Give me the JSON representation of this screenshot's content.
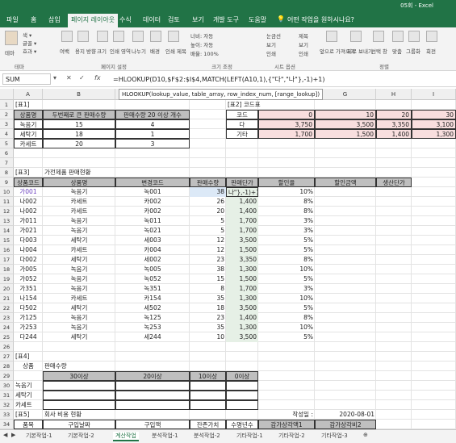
{
  "window": {
    "title": "05회 - Excel"
  },
  "tabs": [
    "파일",
    "홈",
    "삽입",
    "페이지 레이아웃",
    "수식",
    "데이터",
    "검토",
    "보기",
    "개발 도구",
    "도움말"
  ],
  "search": "어떤 작업을 원하시나요?",
  "ribbon": {
    "groups": [
      "테마",
      "페이지 설정",
      "크기 조정",
      "시트 옵션",
      "정렬"
    ],
    "theme": [
      "테마",
      "색 ▾",
      "글꼴 ▾",
      "효과 ▾"
    ],
    "page_setup": [
      "여백",
      "용지 방향",
      "크기",
      "인쇄 영역",
      "나누기",
      "배경",
      "인쇄 제목"
    ],
    "scale": [
      "너비: 자동",
      "높이: 자동",
      "배율: 100%"
    ],
    "sheet_opts": [
      "눈금선",
      "제목",
      "보기",
      "보기",
      "인쇄",
      "인쇄"
    ],
    "arrange": [
      "앞으로 가져오기",
      "뒤로 보내기",
      "선택 창",
      "맞춤",
      "그룹화",
      "회전"
    ]
  },
  "formula_bar": {
    "name_box": "SUM",
    "formula": "=HLOOKUP(D10,$F$2:$I$4,MATCH(LEFT(A10,1),{\"다\",\"나\"},-1)+1)",
    "tooltip": "HLOOKUP(lookup_value, table_array, row_index_num, [range_lookup])"
  },
  "columns": [
    "A",
    "B",
    "C",
    "D",
    "E",
    "F",
    "G",
    "H",
    "I"
  ],
  "rows": [
    "1",
    "2",
    "3",
    "4",
    "5",
    "6",
    "7",
    "8",
    "9",
    "10",
    "11",
    "12",
    "13",
    "14",
    "15",
    "16",
    "17",
    "18",
    "19",
    "20",
    "21",
    "22",
    "23",
    "24",
    "25",
    "26",
    "27",
    "28",
    "29",
    "30",
    "31",
    "32",
    "33",
    "34"
  ],
  "table1": {
    "title": "[표1]",
    "headers": [
      "상품명",
      "두번째로 큰 판매수량",
      "판매수량 20 이상 개수"
    ],
    "rows": [
      [
        "녹음기",
        "15",
        "4"
      ],
      [
        "세탁기",
        "18",
        "1"
      ],
      [
        "카세트",
        "20",
        "3"
      ]
    ]
  },
  "table2": {
    "title": "[표2] 코드표",
    "rows": [
      [
        "코드",
        "0",
        "10",
        "20",
        "30"
      ],
      [
        "다",
        "3,750",
        "3,500",
        "3,350",
        "3,100"
      ],
      [
        "기타",
        "1,700",
        "1,500",
        "1,400",
        "1,300"
      ]
    ]
  },
  "table3": {
    "title": "[표3]",
    "subtitle": "가전제품 판매현황",
    "headers": [
      "상품코드",
      "상품명",
      "변경코드",
      "판매수량",
      "판매단가",
      "할인율",
      "할인금액",
      "생산단가"
    ],
    "editing_cell": "나\"},-1)+1",
    "rows": [
      [
        "가001",
        "녹음기",
        "녹001",
        "38",
        "",
        "10%"
      ],
      [
        "나002",
        "카세트",
        "카002",
        "26",
        "1,400",
        "8%"
      ],
      [
        "나002",
        "카세트",
        "카002",
        "20",
        "1,400",
        "8%"
      ],
      [
        "가011",
        "녹음기",
        "녹011",
        "5",
        "1,700",
        "3%"
      ],
      [
        "가021",
        "녹음기",
        "녹021",
        "5",
        "1,700",
        "3%"
      ],
      [
        "다003",
        "세탁기",
        "세003",
        "12",
        "3,500",
        "5%"
      ],
      [
        "나004",
        "카세트",
        "카004",
        "12",
        "1,500",
        "5%"
      ],
      [
        "다002",
        "세탁기",
        "세002",
        "23",
        "3,350",
        "8%"
      ],
      [
        "가005",
        "녹음기",
        "녹005",
        "38",
        "1,300",
        "10%"
      ],
      [
        "가052",
        "녹음기",
        "녹052",
        "15",
        "1,500",
        "5%"
      ],
      [
        "가351",
        "녹음기",
        "녹351",
        "8",
        "1,700",
        "3%"
      ],
      [
        "나154",
        "카세트",
        "카154",
        "35",
        "1,300",
        "10%"
      ],
      [
        "다502",
        "세탁기",
        "세502",
        "18",
        "3,500",
        "5%"
      ],
      [
        "가125",
        "녹음기",
        "녹125",
        "23",
        "1,400",
        "8%"
      ],
      [
        "가253",
        "녹음기",
        "녹253",
        "35",
        "1,300",
        "10%"
      ],
      [
        "다244",
        "세탁기",
        "세244",
        "10",
        "3,500",
        "5%"
      ]
    ]
  },
  "table4": {
    "title": "[표4]",
    "h1": "상품",
    "h2": "판매수량",
    "sub": [
      "30이상",
      "20이상",
      "10이상",
      "0이상"
    ],
    "items": [
      "녹음기",
      "세탁기",
      "카세트"
    ]
  },
  "table5": {
    "title": "[표5]",
    "subtitle": "회사 비용 현황",
    "date_label": "작성일 :",
    "date": "2020-08-01",
    "headers": [
      "품목",
      "구입날짜",
      "구입액",
      "잔존가치",
      "수명년수",
      "감가상각액1",
      "감가상각비2"
    ]
  },
  "sheets": [
    "기본작업-1",
    "기본작업-2",
    "계산작업",
    "분석작업-1",
    "분석작업-2",
    "기타작업-1",
    "기타작업-2",
    "기타작업-3"
  ],
  "active_sheet": "계산작업"
}
